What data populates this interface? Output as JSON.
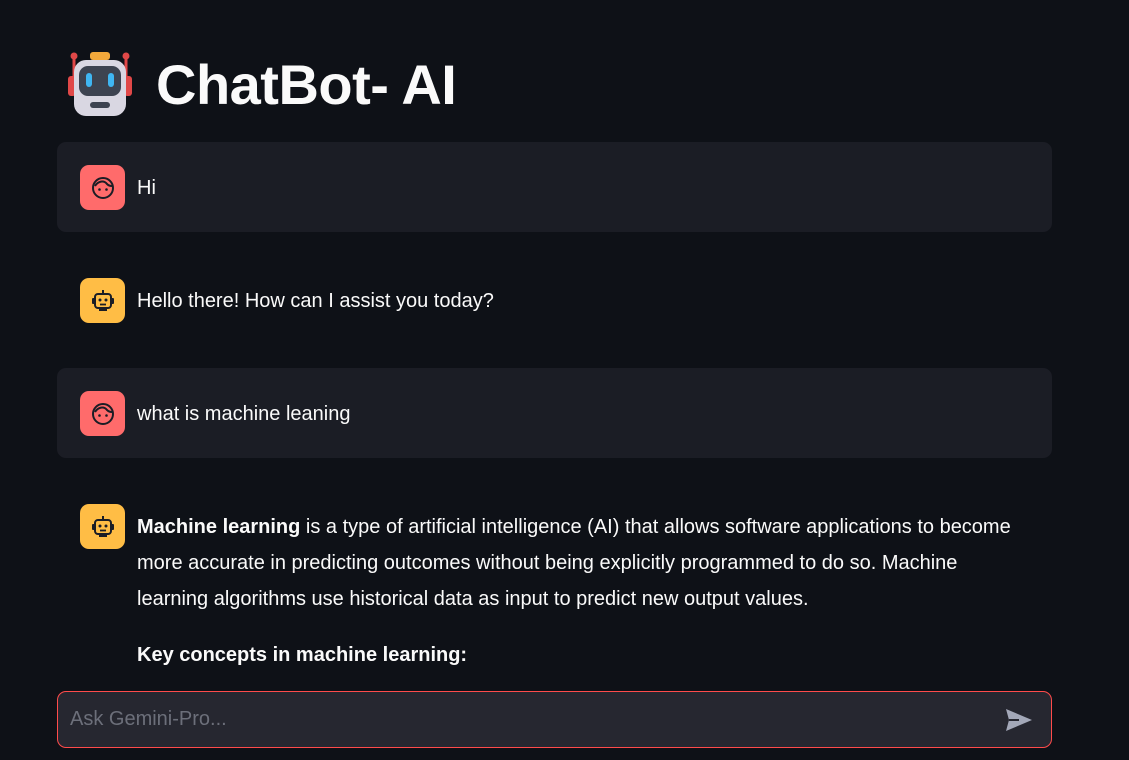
{
  "app": {
    "title": "ChatBot- AI",
    "title_icon": "robot-icon"
  },
  "messages": [
    {
      "role": "user",
      "avatar_icon": "user-face-icon",
      "paragraphs": [
        {
          "bold": "",
          "text": "Hi"
        }
      ]
    },
    {
      "role": "assistant",
      "avatar_icon": "bot-face-icon",
      "paragraphs": [
        {
          "bold": "",
          "text": "Hello there! How can I assist you today?"
        }
      ]
    },
    {
      "role": "user",
      "avatar_icon": "user-face-icon",
      "paragraphs": [
        {
          "bold": "",
          "text": "what is machine leaning"
        }
      ]
    },
    {
      "role": "assistant",
      "avatar_icon": "bot-face-icon",
      "paragraphs": [
        {
          "bold": "Machine learning",
          "text": " is a type of artificial intelligence (AI) that allows software applications to become more accurate in predicting outcomes without being explicitly programmed to do so. Machine learning algorithms use historical data as input to predict new output values."
        },
        {
          "bold": "Key concepts in machine learning:",
          "text": ""
        }
      ]
    }
  ],
  "input": {
    "placeholder": "Ask Gemini-Pro...",
    "value": "",
    "send_icon": "send-icon"
  },
  "colors": {
    "background": "#0e1117",
    "user_message_bg": "#1b1d25",
    "user_avatar": "#ff6b6b",
    "bot_avatar": "#ffbd45",
    "input_border": "#ff4b4b",
    "input_bg": "#262730"
  }
}
